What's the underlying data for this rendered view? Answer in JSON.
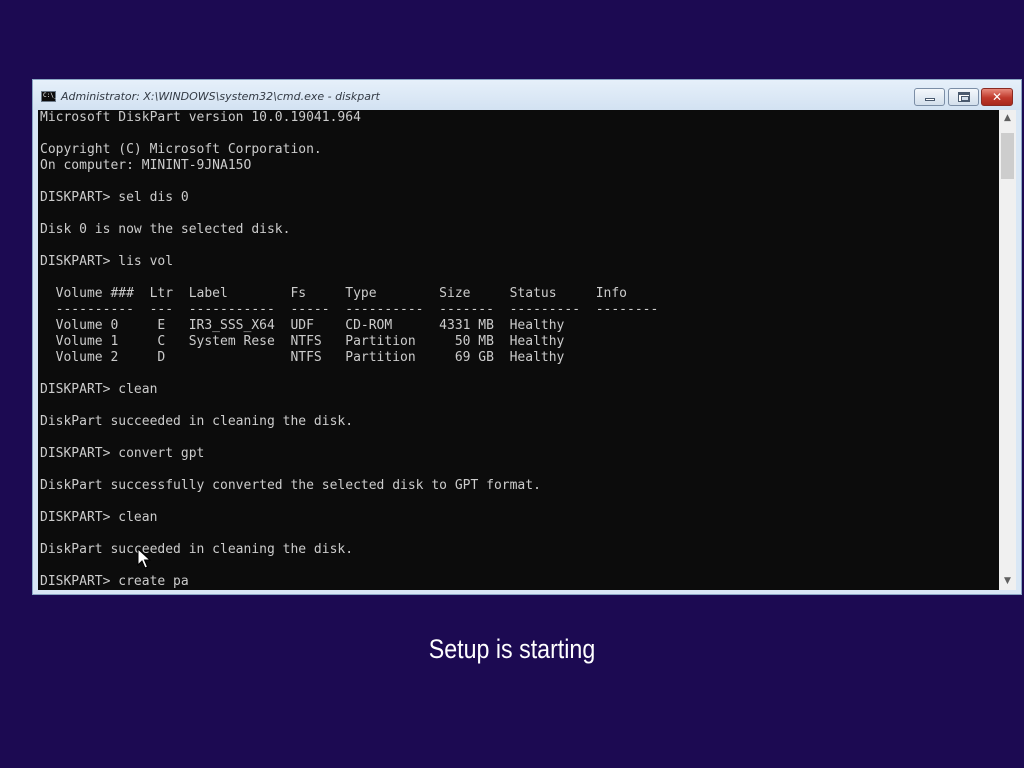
{
  "window": {
    "title": "Administrator: X:\\WINDOWS\\system32\\cmd.exe - diskpart",
    "icon_name": "cmd-icon",
    "icon_text": "C:\\_",
    "minimize_icon": "minimize-icon",
    "maximize_icon": "maximize-icon",
    "close_icon": "close-icon",
    "close_glyph": "✕"
  },
  "console": {
    "background": "#0c0c0c",
    "foreground": "#cccccc",
    "lines": [
      "Microsoft DiskPart version 10.0.19041.964",
      "",
      "Copyright (C) Microsoft Corporation.",
      "On computer: MININT-9JNA15O",
      "",
      "DISKPART> sel dis 0",
      "",
      "Disk 0 is now the selected disk.",
      "",
      "DISKPART> lis vol",
      "",
      "  Volume ###  Ltr  Label        Fs     Type        Size     Status     Info",
      "  ----------  ---  -----------  -----  ----------  -------  ---------  --------",
      "  Volume 0     E   IR3_SSS_X64  UDF    CD-ROM      4331 MB  Healthy",
      "  Volume 1     C   System Rese  NTFS   Partition     50 MB  Healthy",
      "  Volume 2     D                NTFS   Partition     69 GB  Healthy",
      "",
      "DISKPART> clean",
      "",
      "DiskPart succeeded in cleaning the disk.",
      "",
      "DISKPART> convert gpt",
      "",
      "DiskPart successfully converted the selected disk to GPT format.",
      "",
      "DISKPART> clean",
      "",
      "DiskPart succeeded in cleaning the disk.",
      "",
      "DISKPART> create pa"
    ]
  },
  "scrollbar": {
    "up_glyph": "▲",
    "down_glyph": "▼"
  },
  "setup": {
    "message": "Setup is starting"
  },
  "colors": {
    "desktop_background": "#1c0a52",
    "close_button": "#c0392b"
  },
  "cursor": {
    "icon": "mouse-pointer-icon"
  }
}
